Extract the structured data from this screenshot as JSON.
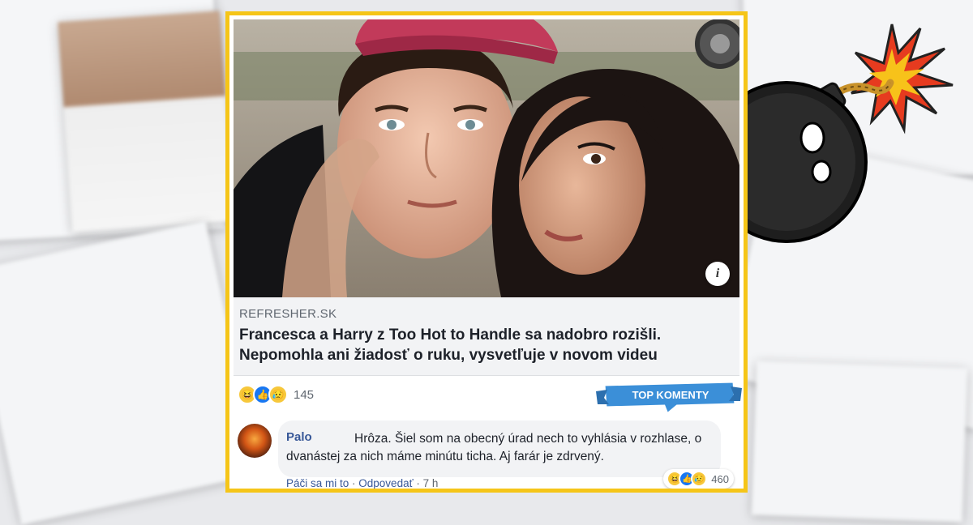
{
  "post": {
    "domain": "REFRESHER.SK",
    "headline_line1": "Francesca a Harry z Too Hot to Handle sa nadobro rozišli.",
    "headline_line2": "Nepomohla ani žiadosť o ruku, vysvetľuje v novom videu",
    "info_label": "i",
    "reaction_count": "145",
    "reaction_icons": [
      "laugh-react-icon",
      "like-react-icon",
      "sad-react-icon"
    ]
  },
  "badge": {
    "label": "TOP KOMENTY"
  },
  "comment": {
    "author": "Palo",
    "text": "Hrôza. Šiel som na obecný úrad nech to vyhlásia v rozhlase, o dvanástej za nich máme minútu ticha. Aj farár je zdrvený.",
    "reaction_count": "460",
    "actions": {
      "like": "Páči sa mi to",
      "sep": " · ",
      "reply": "Odpovedať",
      "time": "7 h"
    }
  },
  "colors": {
    "frame": "#f5c518",
    "link": "#385898",
    "badge_blue": "#3b8fd8",
    "bomb": "#1a1a1a",
    "spark": "#f7c21a"
  }
}
